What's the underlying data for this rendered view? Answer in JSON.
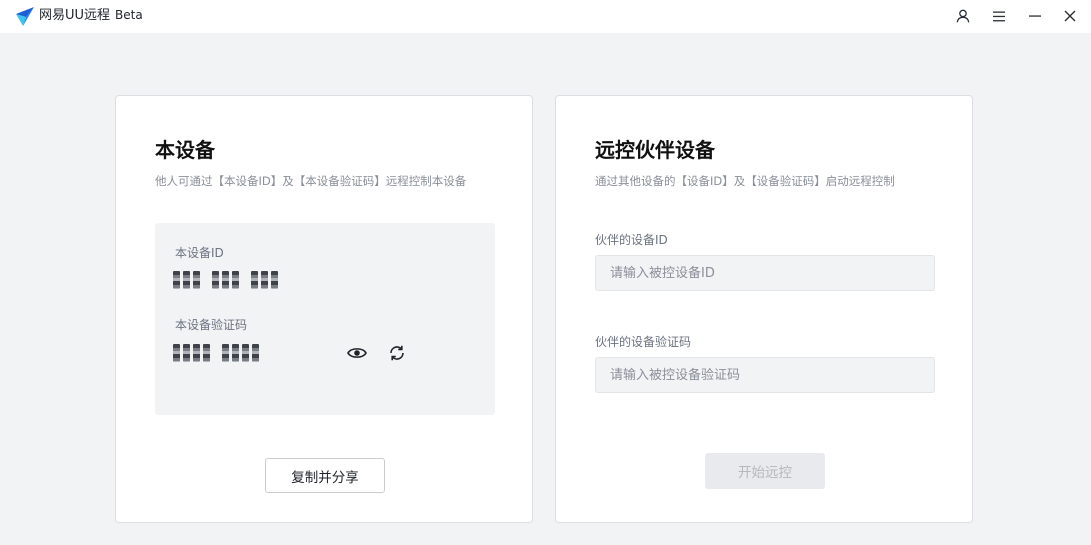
{
  "app": {
    "title": "网易UU远程",
    "badge": "Beta",
    "colors": {
      "logo_primary": "#2f7cf6",
      "logo_secondary": "#39c5f0",
      "background": "#f2f3f5"
    }
  },
  "titlebar": {
    "icons": [
      "user-icon",
      "menu-icon",
      "minimize-icon",
      "close-icon"
    ]
  },
  "this_device": {
    "title": "本设备",
    "subtitle": "他人可通过【本设备ID】及【本设备验证码】远程控制本设备",
    "id_label": "本设备ID",
    "code_label": "本设备验证码",
    "copy_button": "复制并分享"
  },
  "partner_device": {
    "title": "远控伙伴设备",
    "subtitle": "通过其他设备的【设备ID】及【设备验证码】启动远程控制",
    "id_label": "伙伴的设备ID",
    "id_placeholder": "请输入被控设备ID",
    "code_label": "伙伴的设备验证码",
    "code_placeholder": "请输入被控设备验证码",
    "start_button": "开始远控"
  }
}
